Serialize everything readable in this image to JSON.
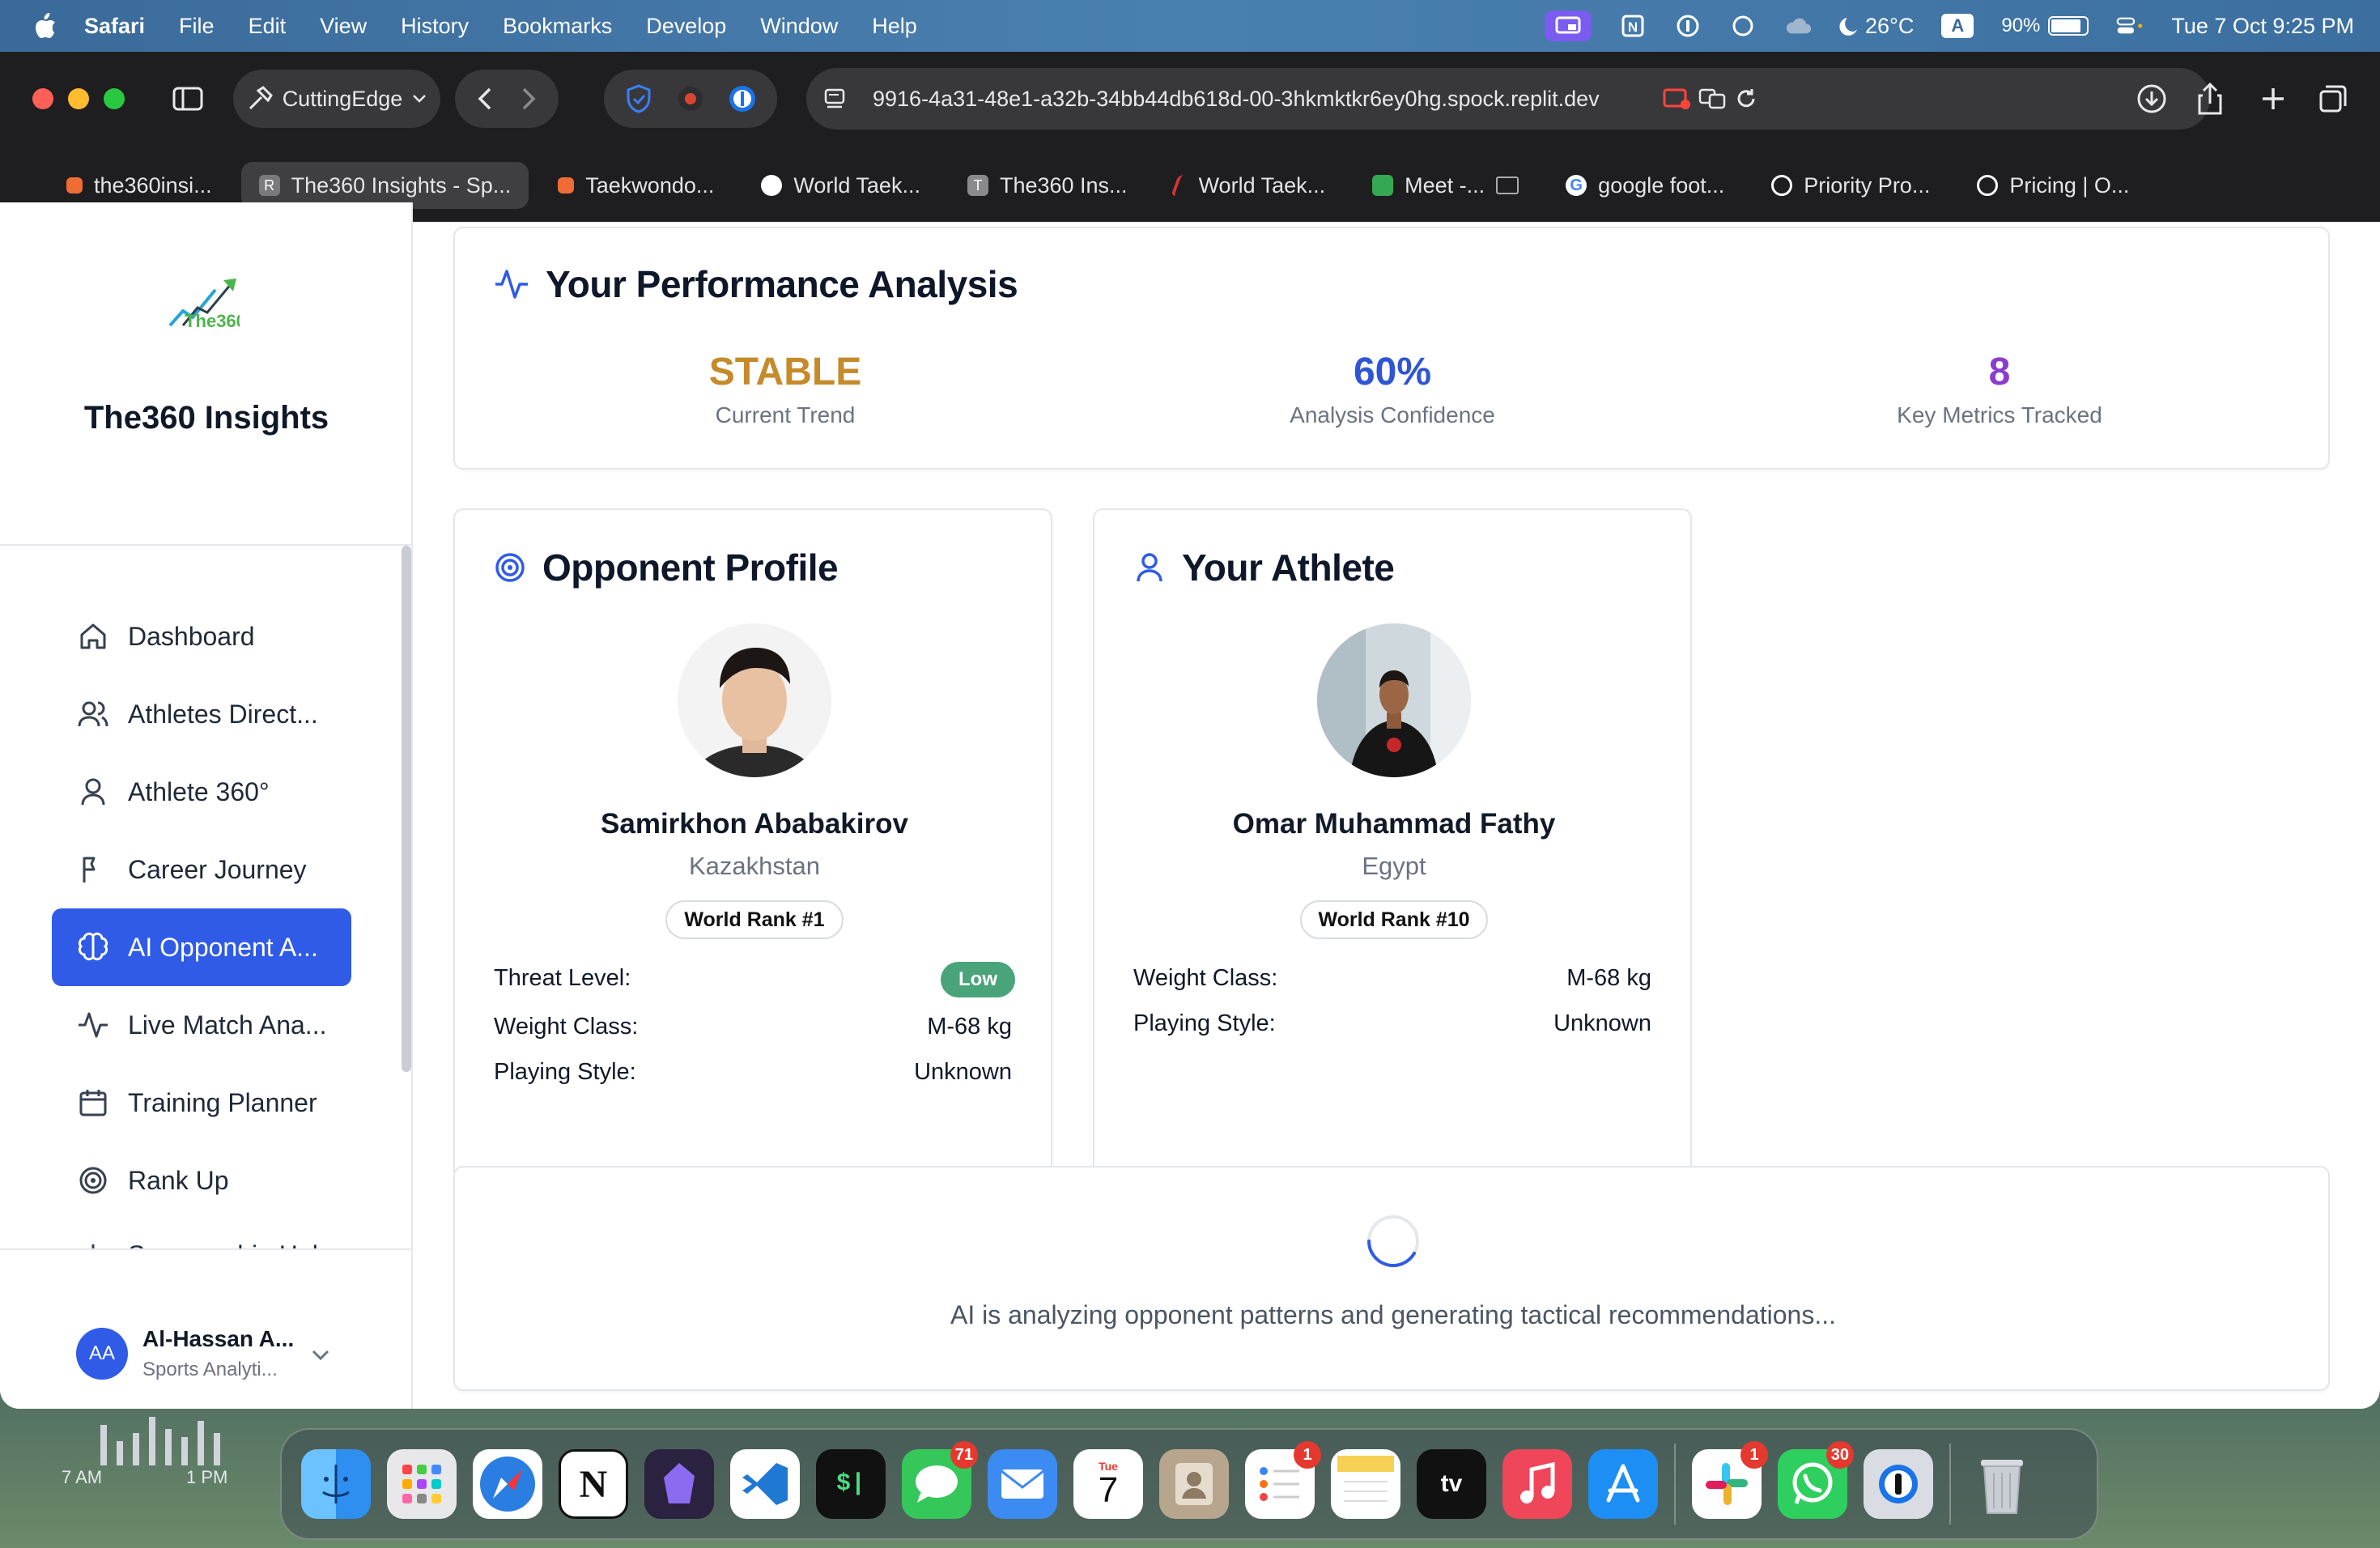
{
  "menubar": {
    "app": "Safari",
    "items": [
      "File",
      "Edit",
      "View",
      "History",
      "Bookmarks",
      "Develop",
      "Window",
      "Help"
    ],
    "temperature": "26°C",
    "keyboard": "A",
    "battery": "90%",
    "datetime": "Tue 7 Oct  9:25 PM"
  },
  "browser": {
    "profile_label": "CuttingEdge",
    "url": "9916-4a31-48e1-a32b-34bb44db618d-00-3hkmktkr6ey0hg.spock.replit.dev",
    "tabs": [
      {
        "label": "the360insi...",
        "color": "#ef6c35"
      },
      {
        "label": "The360 Insights - Sp...",
        "color": "#7a7a7e",
        "letter": "R",
        "active": true
      },
      {
        "label": "Taekwondo...",
        "color": "#ef6c35"
      },
      {
        "label": "World Taek...",
        "color": "#ffffff"
      },
      {
        "label": "The360 Ins...",
        "color": "#8a8a8e",
        "letter": "T"
      },
      {
        "label": "World Taek...",
        "color": "#d33"
      },
      {
        "label": "Meet -...",
        "color": "#34a853"
      },
      {
        "label": "google foot...",
        "color": "#4285f4",
        "letter": "G"
      },
      {
        "label": "Priority Pro...",
        "color": "#ffffff"
      },
      {
        "label": "Pricing | O...",
        "color": "#ffffff"
      }
    ]
  },
  "sidebar": {
    "brand_logo_text": "The360",
    "brand_name": "The360 Insights",
    "items": [
      {
        "label": "Dashboard",
        "icon": "home-icon"
      },
      {
        "label": "Athletes Direct...",
        "icon": "users-icon"
      },
      {
        "label": "Athlete 360°",
        "icon": "user-icon"
      },
      {
        "label": "Career Journey",
        "icon": "flag-icon"
      },
      {
        "label": "AI Opponent A...",
        "icon": "brain-icon",
        "active": true
      },
      {
        "label": "Live Match Ana...",
        "icon": "activity-icon"
      },
      {
        "label": "Training Planner",
        "icon": "calendar-icon"
      },
      {
        "label": "Rank Up",
        "icon": "target-icon"
      },
      {
        "label": "Sponsorship Hub",
        "icon": "dollar-icon"
      }
    ],
    "user": {
      "initials": "AA",
      "name": "Al-Hassan A...",
      "role": "Sports Analyti..."
    }
  },
  "performance": {
    "title": "Your Performance Analysis",
    "stats": [
      {
        "value": "STABLE",
        "label": "Current Trend",
        "color": "#c58a2a"
      },
      {
        "value": "60%",
        "label": "Analysis Confidence",
        "color": "#2f55d4"
      },
      {
        "value": "8",
        "label": "Key Metrics Tracked",
        "color": "#8a3ccf"
      }
    ]
  },
  "opponent": {
    "title": "Opponent Profile",
    "name": "Samirkhon Ababakirov",
    "country": "Kazakhstan",
    "rank": "World Rank #1",
    "threat_label": "Threat Level:",
    "threat_value": "Low",
    "weight_label": "Weight Class:",
    "weight_value": "M-68 kg",
    "style_label": "Playing Style:",
    "style_value": "Unknown"
  },
  "athlete": {
    "title": "Your Athlete",
    "name": "Omar Muhammad Fathy",
    "country": "Egypt",
    "rank": "World Rank #10",
    "weight_label": "Weight Class:",
    "weight_value": "M-68 kg",
    "style_label": "Playing Style:",
    "style_value": "Unknown"
  },
  "loading": {
    "message": "AI is analyzing opponent patterns and generating tactical recommendations..."
  },
  "desktop_widget": {
    "left_time": "7 AM",
    "right_time": "1 PM"
  },
  "dock": {
    "apps": [
      {
        "name": "Finder",
        "color": "#2f8ff0"
      },
      {
        "name": "Launchpad",
        "color": "#e8e8ea"
      },
      {
        "name": "Safari",
        "color": "#2a7de1"
      },
      {
        "name": "Notion",
        "color": "#ffffff",
        "letter": "N"
      },
      {
        "name": "Obsidian",
        "color": "#4b3b8f"
      },
      {
        "name": "VS Code",
        "color": "#1f78d1"
      },
      {
        "name": "Terminal",
        "color": "#111111",
        "letter": "$|"
      },
      {
        "name": "Messages",
        "color": "#35c759",
        "badge": "71"
      },
      {
        "name": "Mail",
        "color": "#3b8bf2"
      },
      {
        "name": "Calendar",
        "color": "#ffffff",
        "letter": "7"
      },
      {
        "name": "Contacts",
        "color": "#b7a58e"
      },
      {
        "name": "Reminders",
        "color": "#ffffff",
        "badge": "1"
      },
      {
        "name": "Notes",
        "color": "#f7d154"
      },
      {
        "name": "Apple TV",
        "color": "#111111",
        "letter": "tv"
      },
      {
        "name": "Music",
        "color": "#f0465a"
      },
      {
        "name": "App Store",
        "color": "#1d8ef3"
      },
      {
        "name": "Slack",
        "color": "#ffffff",
        "badge": "1"
      },
      {
        "name": "WhatsApp",
        "color": "#2fcf5f",
        "badge": "30"
      },
      {
        "name": "1Password",
        "color": "#d9dde3"
      },
      {
        "name": "Trash",
        "color": "#c9ced4"
      }
    ]
  }
}
